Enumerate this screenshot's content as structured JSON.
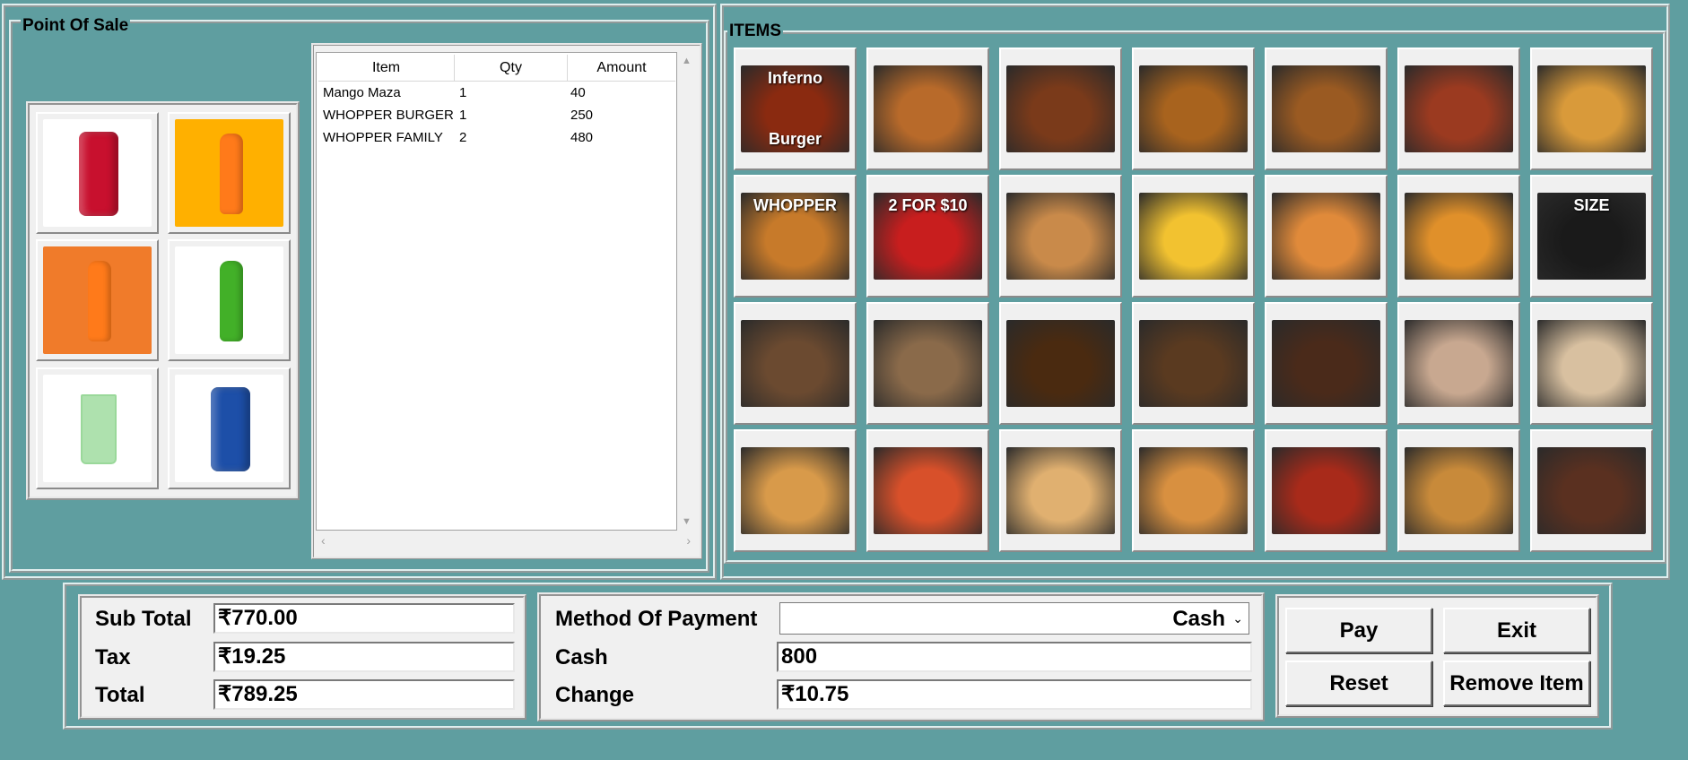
{
  "pos_frame": {
    "title": "Point Of Sale"
  },
  "items_frame": {
    "title": "ITEMS"
  },
  "drinks": [
    {
      "name": "coca-cola-can",
      "color": "#c8102e"
    },
    {
      "name": "mango-bottle",
      "color": "#ffb000"
    },
    {
      "name": "orange-bottle",
      "color": "#f07b2a"
    },
    {
      "name": "lime-soda-bottle",
      "color": "#42b028"
    },
    {
      "name": "mojito-glass",
      "color": "#6bc96b"
    },
    {
      "name": "blue-can",
      "color": "#1d4fa8"
    }
  ],
  "order_table": {
    "headers": [
      "Item",
      "Qty",
      "Amount"
    ],
    "rows": [
      {
        "item": "Mango Maza",
        "qty": "1",
        "amount": "40"
      },
      {
        "item": "WHOPPER BURGER",
        "qty": "1",
        "amount": "250"
      },
      {
        "item": "WHOPPER FAMILY",
        "qty": "2",
        "amount": "480"
      }
    ]
  },
  "menu_items": [
    {
      "name": "inferno-burger",
      "caption": "Inferno",
      "caption2": "Burger",
      "color": "#8a2a10"
    },
    {
      "name": "burger-white-bg",
      "color": "#b86a2a"
    },
    {
      "name": "burger-dark-bg",
      "color": "#7a3a1a"
    },
    {
      "name": "cheese-burger",
      "color": "#a8631e"
    },
    {
      "name": "burger-black-bg",
      "color": "#9a5a22"
    },
    {
      "name": "beef-burger",
      "color": "#9b3a20"
    },
    {
      "name": "wrap-snack",
      "color": "#d99a3a"
    },
    {
      "name": "whopper",
      "caption": "WHOPPER",
      "color": "#c77a2a"
    },
    {
      "name": "two-for-ten",
      "caption": "2 FOR $10",
      "color": "#c81e1e"
    },
    {
      "name": "spring-rolls",
      "color": "#c98a4a"
    },
    {
      "name": "french-fries-bowl",
      "color": "#f2c230"
    },
    {
      "name": "chicken-nuggets",
      "color": "#e08a3a"
    },
    {
      "name": "fries-plate",
      "color": "#e0902a"
    },
    {
      "name": "sauce-tub",
      "caption": "SIZE",
      "color": "#1a1a1a"
    },
    {
      "name": "cappuccino",
      "color": "#6b4a30"
    },
    {
      "name": "frappe-duo",
      "color": "#8a6a4a"
    },
    {
      "name": "espresso",
      "color": "#4a2a10"
    },
    {
      "name": "iced-coffee",
      "color": "#5a3a20"
    },
    {
      "name": "chocolate-cake",
      "color": "#4a2a1a"
    },
    {
      "name": "hot-chocolate",
      "color": "#c8a890"
    },
    {
      "name": "ice-cream-cone",
      "color": "#d8c0a0"
    },
    {
      "name": "samosa",
      "color": "#d89a4a"
    },
    {
      "name": "pasta-bowl",
      "color": "#d8502a"
    },
    {
      "name": "veg-rolls",
      "color": "#e0b070"
    },
    {
      "name": "noodles",
      "color": "#d89040"
    },
    {
      "name": "manchurian",
      "color": "#a82a1a"
    },
    {
      "name": "tacos",
      "color": "#c88a3a"
    },
    {
      "name": "choco-cone",
      "color": "#5a3020"
    }
  ],
  "totals": {
    "sub_total_label": "Sub Total",
    "sub_total_value": "₹770.00",
    "tax_label": "Tax",
    "tax_value": "₹19.25",
    "total_label": "Total",
    "total_value": "₹789.25"
  },
  "payment": {
    "method_label": "Method Of Payment",
    "method_value": "Cash",
    "cash_label": "Cash",
    "cash_value": "800",
    "change_label": "Change",
    "change_value": "₹10.75"
  },
  "buttons": {
    "pay": "Pay",
    "exit": "Exit",
    "reset": "Reset",
    "remove": "Remove Item"
  }
}
